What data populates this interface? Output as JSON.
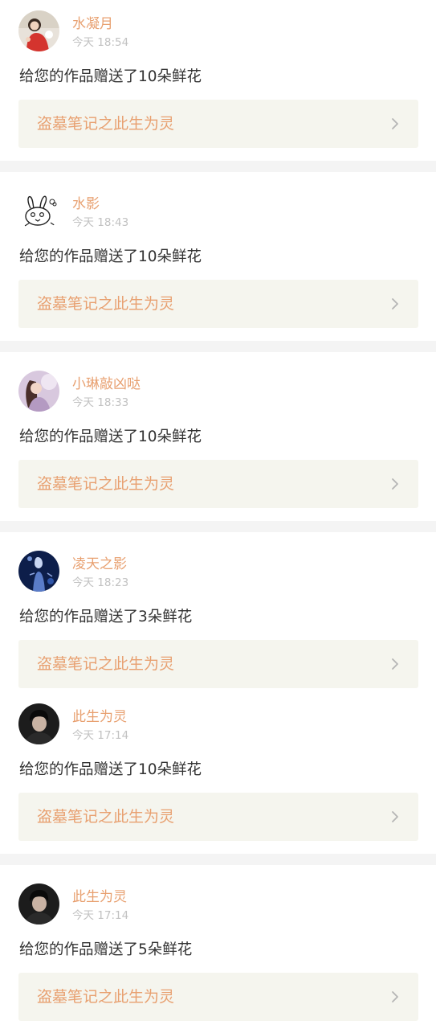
{
  "notifications": [
    {
      "username": "水凝月",
      "time": "今天 18:54",
      "message": "给您的作品赠送了10朵鲜花",
      "work_title": "盗墓笔记之此生为灵",
      "avatar_icon": "avatar-photo-girl-red-dress"
    },
    {
      "username": "水影",
      "time": "今天 18:43",
      "message": "给您的作品赠送了10朵鲜花",
      "work_title": "盗墓笔记之此生为灵",
      "avatar_icon": "avatar-cartoon-bunny-sketch"
    },
    {
      "username": "小琳敲凶哒",
      "time": "今天 18:33",
      "message": "给您的作品赠送了10朵鲜花",
      "work_title": "盗墓笔记之此生为灵",
      "avatar_icon": "avatar-photo-girl-purple"
    },
    {
      "username": "凌天之影",
      "time": "今天 18:23",
      "message": "给您的作品赠送了3朵鲜花",
      "work_title": "盗墓笔记之此生为灵",
      "avatar_icon": "avatar-photo-dark-blue-figure"
    },
    {
      "username": "此生为灵",
      "time": "今天 17:14",
      "message": "给您的作品赠送了10朵鲜花",
      "work_title": "盗墓笔记之此生为灵",
      "avatar_icon": "avatar-photo-dark-boy"
    },
    {
      "username": "此生为灵",
      "time": "今天 17:14",
      "message": "给您的作品赠送了5朵鲜花",
      "work_title": "盗墓笔记之此生为灵",
      "avatar_icon": "avatar-photo-dark-boy"
    }
  ],
  "colors": {
    "accent_orange": "#e8a070",
    "time_gray": "#c2c2c2",
    "message_text": "#333333",
    "link_box_bg": "#f5f5ee",
    "separator_bg": "#f4f4f4"
  }
}
